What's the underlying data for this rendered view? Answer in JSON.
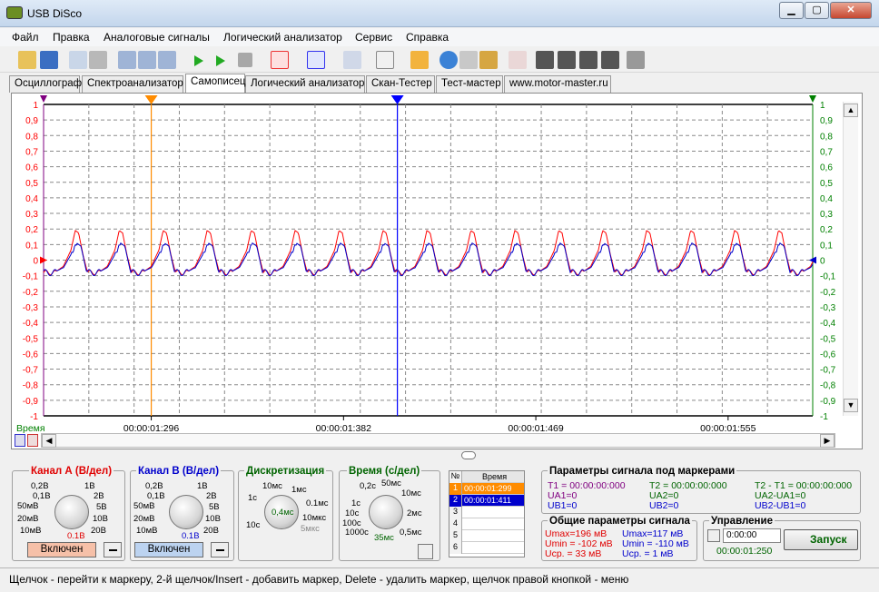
{
  "window": {
    "title": "USB DiSco",
    "minimize": "▁",
    "maximize": "▢",
    "close": "✕"
  },
  "menu": [
    "Файл",
    "Правка",
    "Аналоговые сигналы",
    "Логический анализатор",
    "Сервис",
    "Справка"
  ],
  "tabs": [
    "Осциллограф",
    "Спектроанализатор",
    "Самописец",
    "Логический анализатор",
    "Скан-Тестер",
    "Тест-мастер",
    "www.motor-master.ru"
  ],
  "chart_data": {
    "type": "line",
    "y_left": {
      "range": [
        -1,
        1
      ],
      "ticks": [
        "1",
        "0,9",
        "0,8",
        "0,7",
        "0,6",
        "0,5",
        "0,4",
        "0,3",
        "0,2",
        "0,1",
        "0",
        "-0,1",
        "-0,2",
        "-0,3",
        "-0,4",
        "-0,5",
        "-0,6",
        "-0,7",
        "-0,8",
        "-0,9",
        "-1"
      ],
      "color": "#ff0000"
    },
    "y_right": {
      "range": [
        -1,
        1
      ],
      "ticks": [
        "1",
        "0,9",
        "0,8",
        "0,7",
        "0,6",
        "0,5",
        "0,4",
        "0,3",
        "0,2",
        "0,1",
        "0",
        "-0,1",
        "-0,2",
        "-0,3",
        "-0,4",
        "-0,5",
        "-0,6",
        "-0,7",
        "-0,8",
        "-0,9",
        "-1"
      ],
      "color": "#008000"
    },
    "x_label": "Время",
    "x_ticks": [
      "00:00:01:296",
      "00:00:01:382",
      "00:00:01:469",
      "00:00:01:555"
    ],
    "series": [
      {
        "channel": "A",
        "color": "#ff0000",
        "period": 0.0485,
        "peak": 0.196,
        "min": -0.102
      },
      {
        "channel": "B",
        "color": "#0000cc",
        "period": 0.0485,
        "peak": 0.117,
        "min": -0.11
      }
    ],
    "markers": [
      {
        "id": 1,
        "time": "00:00:01:299",
        "color": "#ff8c00"
      },
      {
        "id": 2,
        "time": "00:00:01:411",
        "color": "#0000ff"
      }
    ],
    "grid": true
  },
  "channelA": {
    "title": "Канал А (В/дел)",
    "labels": [
      "0,2В",
      "0,1В",
      "50мВ",
      "20мВ",
      "10мВ",
      "1В",
      "2В",
      "5В",
      "10В",
      "20В"
    ],
    "value": "0.1В",
    "button": "Включен"
  },
  "channelB": {
    "title": "Канал В (В/дел)",
    "labels": [
      "0,2В",
      "0,1В",
      "50мВ",
      "20мВ",
      "10мВ",
      "1В",
      "2В",
      "5В",
      "10В",
      "20В"
    ],
    "value": "0.1В",
    "button": "Включен"
  },
  "discret": {
    "title": "Дискретизация",
    "labels": [
      "10мс",
      "1мс",
      "0.1мс",
      "10мкс",
      "5мкс",
      "1с",
      "10с"
    ],
    "value": "0,4мс"
  },
  "time": {
    "title": "Время (с/дел)",
    "labels": [
      "0,2с",
      "50мс",
      "10мс",
      "2мс",
      "0,5мс",
      "35мс",
      "1000с",
      "100с",
      "10с",
      "1с"
    ]
  },
  "marker_table": {
    "headers": [
      "№",
      "Время"
    ],
    "rows": [
      {
        "n": "1",
        "t": "00:00:01:299"
      },
      {
        "n": "2",
        "t": "00:00:01:411"
      },
      {
        "n": "3",
        "t": ""
      },
      {
        "n": "4",
        "t": ""
      },
      {
        "n": "5",
        "t": ""
      },
      {
        "n": "6",
        "t": ""
      }
    ]
  },
  "params_markers": {
    "title": "Параметры сигнала под маркерами",
    "t1": "Т1 = 00:00:00:000",
    "ua1": "UA1=0",
    "ub1": "UB1=0",
    "t2": "Т2 = 00:00:00:000",
    "ua2": "UA2=0",
    "ub2": "UB2=0",
    "dt": "Т2 - Т1 = 00:00:00:000",
    "dua": "UA2-UA1=0",
    "dub": "UB2-UB1=0"
  },
  "params_general": {
    "title": "Общие параметры сигнала",
    "a": [
      "Umax=196 мВ",
      "Umin = -102 мВ",
      "Uср. =  33 мВ"
    ],
    "b": [
      "Umax=117 мВ",
      "Umin = -110 мВ",
      "Uср. =   1 мВ"
    ]
  },
  "control": {
    "title": "Управление",
    "time": "0:00:00",
    "elapsed": "00:00:01:250",
    "start": "Запуск"
  },
  "status": "Щелчок - перейти к маркеру, 2-й щелчок/Insert - добавить маркер, Delete - удалить маркер, щелчок правой кнопкой - меню",
  "colors": {
    "accent": "#3366cc",
    "chA": "#ff0000",
    "chB": "#0000cc",
    "marker1": "#ff8c00",
    "grid": "#808080"
  }
}
